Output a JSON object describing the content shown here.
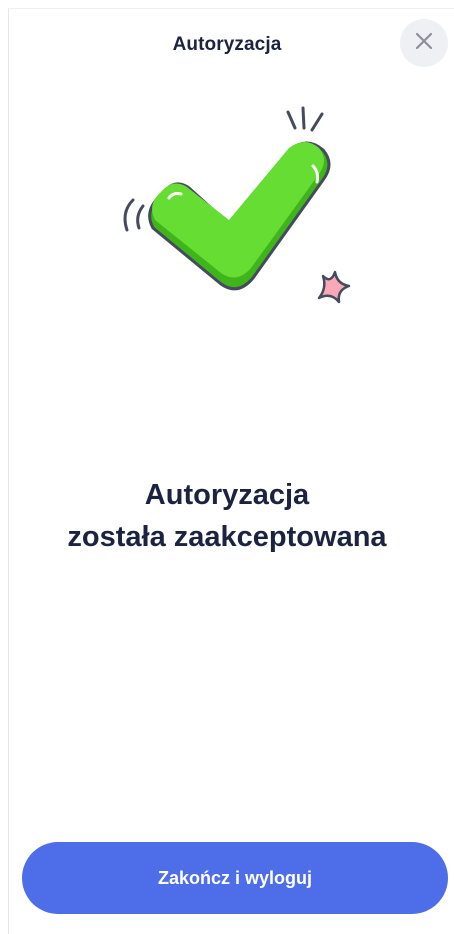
{
  "header": {
    "title": "Autoryzacja",
    "close_icon": "close-icon"
  },
  "illustration": {
    "icon": "checkmark-success-illustration",
    "check_color": "#5fd92f",
    "sparkle_color": "#f7a9b8"
  },
  "message": {
    "line1": "Autoryzacja",
    "line2": "została zaakceptowana"
  },
  "actions": {
    "primary_label": "Zakończ i wyloguj",
    "primary_color": "#4d6ee8"
  }
}
